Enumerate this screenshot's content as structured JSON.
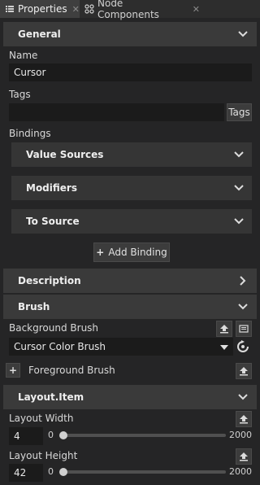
{
  "tabs": [
    {
      "label": "Properties",
      "close": "✕"
    },
    {
      "label": "Node Components",
      "close": "✕"
    }
  ],
  "general": {
    "title": "General",
    "name_label": "Name",
    "name_value": "Cursor",
    "tags_label": "Tags",
    "tags_value": "",
    "tags_button": "Tags",
    "bindings_label": "Bindings",
    "value_sources": "Value Sources",
    "modifiers": "Modifiers",
    "to_source": "To Source",
    "add_binding": "Add Binding"
  },
  "description": {
    "title": "Description"
  },
  "brush": {
    "title": "Brush",
    "background_label": "Background Brush",
    "background_value": "Cursor Color Brush",
    "foreground_label": "Foreground Brush"
  },
  "layout_item": {
    "title": "Layout.Item",
    "width_label": "Layout Width",
    "width_value": "4",
    "width_min": "0",
    "width_max": "2000",
    "height_label": "Layout Height",
    "height_value": "42",
    "height_min": "0",
    "height_max": "2000"
  },
  "colors": {
    "panel": "#252526",
    "section": "#3a3a3a",
    "field": "#1b1b1b"
  }
}
